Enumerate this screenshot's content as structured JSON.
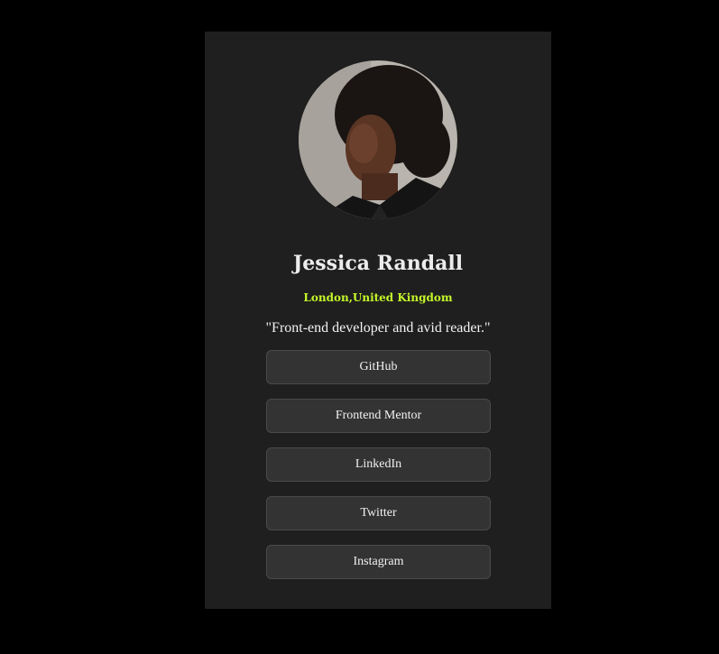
{
  "profile": {
    "name": "Jessica Randall",
    "location": "London,United Kingdom",
    "bio": "\"Front-end developer and avid reader.\""
  },
  "links": [
    {
      "label": "GitHub"
    },
    {
      "label": "Frontend Mentor"
    },
    {
      "label": "LinkedIn"
    },
    {
      "label": "Twitter"
    },
    {
      "label": "Instagram"
    }
  ],
  "colors": {
    "background": "#000000",
    "card": "#1f1f1f",
    "accent": "#c5f82a",
    "button": "#333333"
  }
}
